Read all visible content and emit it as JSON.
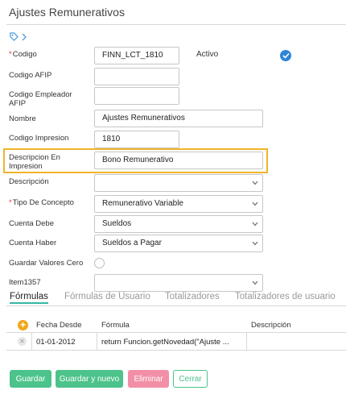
{
  "header": {
    "title": "Ajustes Remunerativos",
    "icons": [
      "tag-icon",
      "chevron-right-icon"
    ]
  },
  "form": {
    "codigo": {
      "label": "Codigo",
      "value": "FINN_LCT_1810",
      "required": true
    },
    "activo": {
      "label": "Activo",
      "checked": true
    },
    "codigo_afip": {
      "label": "Codigo AFIP",
      "value": ""
    },
    "codigo_empleador_afip": {
      "label_line1": "Codigo Empleador",
      "label_line2": "AFIP",
      "value": ""
    },
    "nombre": {
      "label": "Nombre",
      "value": "Ajustes Remunerativos"
    },
    "codigo_impresion": {
      "label": "Codigo Impresion",
      "value": "1810"
    },
    "descripcion_impresion": {
      "label_line1": "Descripcion En",
      "label_line2": "Impresion",
      "value": "Bono Remunerativo",
      "highlight_color": "#f0b429"
    },
    "descripcion": {
      "label": "Descripción",
      "value": ""
    },
    "tipo_concepto": {
      "label": "Tipo De Concepto",
      "value": "Remunerativo Variable",
      "required": true
    },
    "cuenta_debe": {
      "label": "Cuenta Debe",
      "value": "Sueldos"
    },
    "cuenta_haber": {
      "label": "Cuenta Haber",
      "value": "Sueldos a Pagar"
    },
    "guardar_valores_cero": {
      "label": "Guardar Valores Cero",
      "checked": false
    },
    "item1357": {
      "label": "Item1357",
      "value": ""
    }
  },
  "tabs": [
    {
      "label": "Fórmulas",
      "active": true
    },
    {
      "label": "Fórmulas de Usuario",
      "active": false
    },
    {
      "label": "Totalizadores",
      "active": false
    },
    {
      "label": "Totalizadores de usuario",
      "active": false
    }
  ],
  "formulas_table": {
    "columns": [
      "Fecha Desde",
      "Fórmula",
      "Descripción"
    ],
    "rows": [
      {
        "fecha_desde": "01-01-2012",
        "formula": "return Funcion.getNovedad(\"Ajuste ...",
        "descripcion": ""
      }
    ]
  },
  "actions": {
    "guardar": "Guardar",
    "guardar_nuevo": "Guardar y nuevo",
    "eliminar": "Eliminar",
    "cerrar": "Cerrar"
  },
  "colors": {
    "accent": "#4cc38a",
    "danger": "#f28fa6",
    "check": "#2f86d8",
    "tab_underline": "#35b8a4",
    "add_button": "#f0a81a"
  }
}
